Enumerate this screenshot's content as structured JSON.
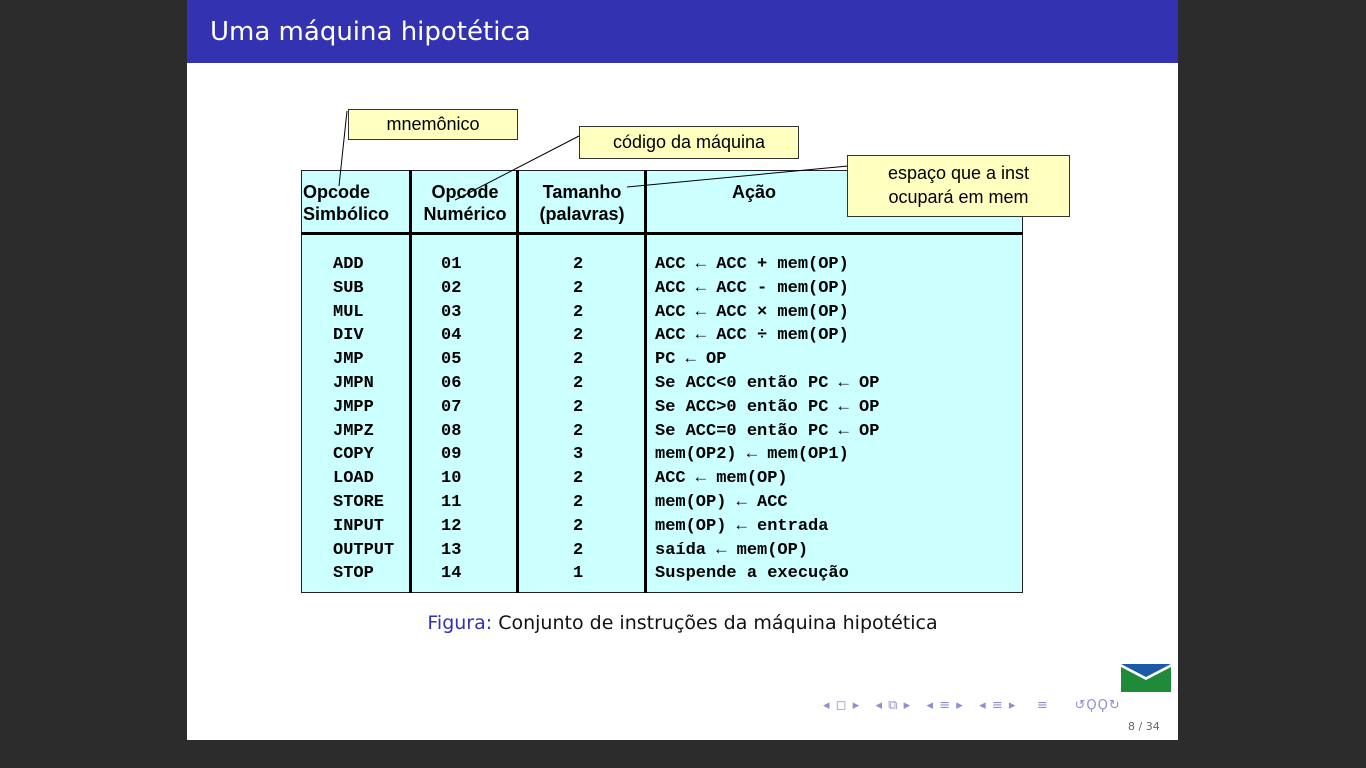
{
  "slide": {
    "title": "Uma máquina hipotética"
  },
  "table": {
    "headers": {
      "symbolic_line1": "Opcode",
      "symbolic_line2": "Simbólico",
      "numeric_line1": "Opcode",
      "numeric_line2": "Numérico",
      "size_line1": "Tamanho",
      "size_line2": "(palavras)",
      "action": "Ação"
    },
    "rows": [
      {
        "sym": "ADD",
        "num": "01",
        "size": "2",
        "action": "ACC ← ACC + mem(OP)"
      },
      {
        "sym": "SUB",
        "num": "02",
        "size": "2",
        "action": "ACC ← ACC - mem(OP)"
      },
      {
        "sym": "MUL",
        "num": "03",
        "size": "2",
        "action": "ACC ← ACC × mem(OP)"
      },
      {
        "sym": "DIV",
        "num": "04",
        "size": "2",
        "action": "ACC ← ACC ÷ mem(OP)"
      },
      {
        "sym": "JMP",
        "num": "05",
        "size": "2",
        "action": "PC ← OP"
      },
      {
        "sym": "JMPN",
        "num": "06",
        "size": "2",
        "action": "Se ACC<0 então PC ← OP"
      },
      {
        "sym": "JMPP",
        "num": "07",
        "size": "2",
        "action": "Se ACC>0 então PC ← OP"
      },
      {
        "sym": "JMPZ",
        "num": "08",
        "size": "2",
        "action": "Se ACC=0 então PC ← OP"
      },
      {
        "sym": "COPY",
        "num": "09",
        "size": "3",
        "action": "mem(OP2) ← mem(OP1)"
      },
      {
        "sym": "LOAD",
        "num": "10",
        "size": "2",
        "action": "ACC ← mem(OP)"
      },
      {
        "sym": "STORE",
        "num": "11",
        "size": "2",
        "action": "mem(OP) ← ACC"
      },
      {
        "sym": "INPUT",
        "num": "12",
        "size": "2",
        "action": "mem(OP) ← entrada"
      },
      {
        "sym": "OUTPUT",
        "num": "13",
        "size": "2",
        "action": "saída ← mem(OP)"
      },
      {
        "sym": "STOP",
        "num": "14",
        "size": "1",
        "action": "Suspende a execução"
      }
    ]
  },
  "callouts": {
    "mnemonic": "mnemônico",
    "machine_code": "código da máquina",
    "space_line1": "espaço que a inst",
    "space_line2": "ocupará em mem"
  },
  "caption": {
    "label": "Figura:",
    "text": "Conjunto de instruções da máquina hipotética"
  },
  "footer": {
    "page": "8 / 34"
  },
  "colors": {
    "title_bar": "#3333b2",
    "table_bg": "#ccffff",
    "callout_bg": "#ffffc0"
  }
}
